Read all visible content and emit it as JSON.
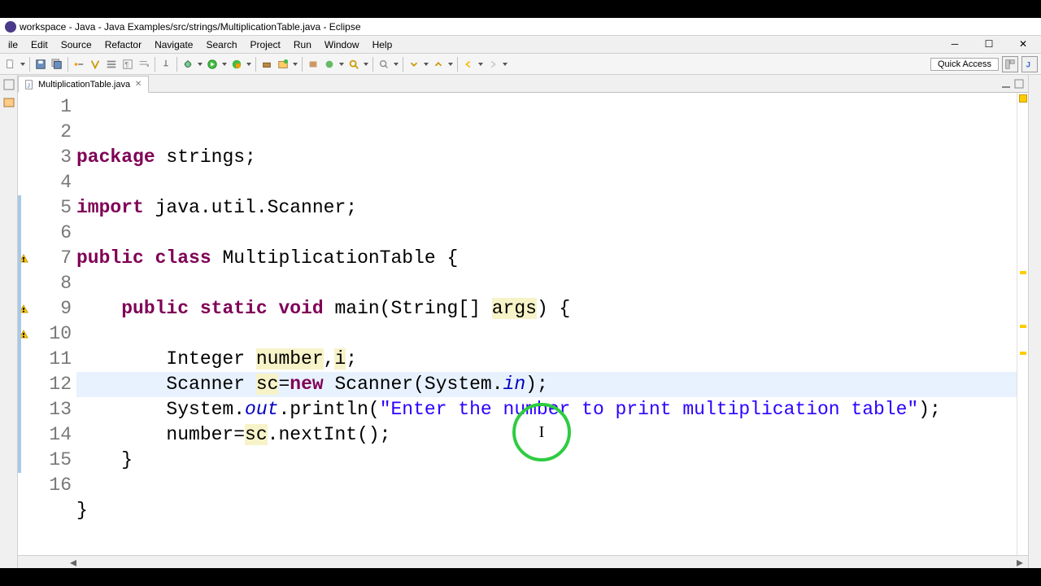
{
  "window": {
    "title": "workspace - Java - Java Examples/src/strings/MultiplicationTable.java - Eclipse"
  },
  "menu": [
    "ile",
    "Edit",
    "Source",
    "Refactor",
    "Navigate",
    "Search",
    "Project",
    "Run",
    "Window",
    "Help"
  ],
  "quick_access": "Quick Access",
  "tab": {
    "label": "MultiplicationTable.java"
  },
  "code": {
    "lines": [
      {
        "n": 1,
        "segs": [
          {
            "t": "package",
            "c": "kw"
          },
          {
            "t": " strings;",
            "c": ""
          }
        ]
      },
      {
        "n": 2,
        "segs": []
      },
      {
        "n": 3,
        "segs": [
          {
            "t": "import",
            "c": "kw"
          },
          {
            "t": " java.util.Scanner;",
            "c": ""
          }
        ]
      },
      {
        "n": 4,
        "segs": []
      },
      {
        "n": 5,
        "segs": [
          {
            "t": "public class",
            "c": "kw"
          },
          {
            "t": " MultiplicationTable {",
            "c": ""
          }
        ]
      },
      {
        "n": 6,
        "segs": []
      },
      {
        "n": 7,
        "segs": [
          {
            "t": "    ",
            "c": ""
          },
          {
            "t": "public static void",
            "c": "kw"
          },
          {
            "t": " main(String[] ",
            "c": ""
          },
          {
            "t": "args",
            "c": "var-warn"
          },
          {
            "t": ") {",
            "c": ""
          }
        ]
      },
      {
        "n": 8,
        "segs": []
      },
      {
        "n": 9,
        "segs": [
          {
            "t": "        Integer ",
            "c": ""
          },
          {
            "t": "number",
            "c": "var-warn"
          },
          {
            "t": ",",
            "c": ""
          },
          {
            "t": "i",
            "c": "var-warn"
          },
          {
            "t": ";",
            "c": ""
          }
        ]
      },
      {
        "n": 10,
        "segs": [
          {
            "t": "        Scanner ",
            "c": ""
          },
          {
            "t": "sc",
            "c": "var-warn"
          },
          {
            "t": "=",
            "c": ""
          },
          {
            "t": "new",
            "c": "kw"
          },
          {
            "t": " Scanner(System.",
            "c": ""
          },
          {
            "t": "in",
            "c": "fld"
          },
          {
            "t": ");",
            "c": ""
          }
        ]
      },
      {
        "n": 11,
        "segs": [
          {
            "t": "        System.",
            "c": ""
          },
          {
            "t": "out",
            "c": "fld"
          },
          {
            "t": ".println(",
            "c": ""
          },
          {
            "t": "\"Enter the number to print multiplication table\"",
            "c": "str"
          },
          {
            "t": ");",
            "c": ""
          }
        ]
      },
      {
        "n": 12,
        "segs": [
          {
            "t": "        number=",
            "c": ""
          },
          {
            "t": "sc",
            "c": "var-warn"
          },
          {
            "t": ".nextInt();",
            "c": ""
          }
        ]
      },
      {
        "n": 13,
        "segs": [
          {
            "t": "    }",
            "c": ""
          }
        ]
      },
      {
        "n": 14,
        "segs": []
      },
      {
        "n": 15,
        "segs": [
          {
            "t": "}",
            "c": ""
          }
        ]
      },
      {
        "n": 16,
        "segs": []
      }
    ],
    "highlighted_line": 12
  },
  "markers": {
    "warnings": [
      7,
      9,
      10
    ],
    "fold_ranges": [
      [
        5,
        15
      ],
      [
        7,
        13
      ]
    ]
  }
}
